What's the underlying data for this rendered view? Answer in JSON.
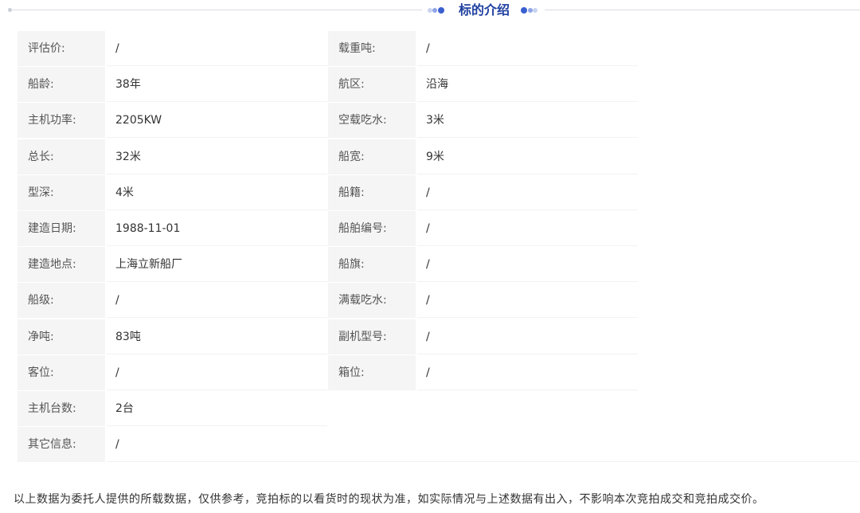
{
  "section": {
    "title": "标的介绍",
    "accent_color": "#1f3fa0",
    "decoration_icons": [
      "dots-left-icon",
      "dots-right-icon"
    ]
  },
  "specs": [
    {
      "left_label": "评估价:",
      "left_value": "/",
      "right_label": "载重吨:",
      "right_value": "/"
    },
    {
      "left_label": "船龄:",
      "left_value": "38年",
      "right_label": "航区:",
      "right_value": "沿海"
    },
    {
      "left_label": "主机功率:",
      "left_value": "2205KW",
      "right_label": "空载吃水:",
      "right_value": "3米"
    },
    {
      "left_label": "总长:",
      "left_value": "32米",
      "right_label": "船宽:",
      "right_value": "9米"
    },
    {
      "left_label": "型深:",
      "left_value": "4米",
      "right_label": "船籍:",
      "right_value": "/"
    },
    {
      "left_label": "建造日期:",
      "left_value": "1988-11-01",
      "right_label": "船舶编号:",
      "right_value": "/"
    },
    {
      "left_label": "建造地点:",
      "left_value": "上海立新船厂",
      "right_label": "船旗:",
      "right_value": "/"
    },
    {
      "left_label": "船级:",
      "left_value": "/",
      "right_label": "满载吃水:",
      "right_value": "/"
    },
    {
      "left_label": "净吨:",
      "left_value": "83吨",
      "right_label": "副机型号:",
      "right_value": "/"
    },
    {
      "left_label": "客位:",
      "left_value": "/",
      "right_label": "箱位:",
      "right_value": "/"
    },
    {
      "left_label": "主机台数:",
      "left_value": "2台"
    }
  ],
  "other_info": {
    "label": "其它信息:",
    "value": "/"
  },
  "footnote": "以上数据为委托人提供的所载数据，仅供参考，竞拍标的以看货时的现状为准，如实际情况与上述数据有出入，不影响本次竞拍成交和竞拍成交价。"
}
